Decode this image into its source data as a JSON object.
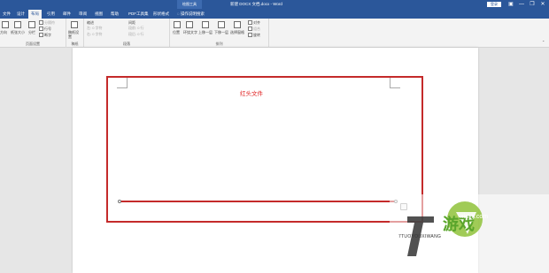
{
  "titlebar": {
    "context_tools": "绘图工具",
    "doc_title": "新建 DOCX 文档.docx  -  Word",
    "login": "登录",
    "minimize": "—",
    "restore": "❐",
    "close": "✕",
    "options": "▣"
  },
  "tabs": [
    "文件",
    "设计",
    "布局",
    "引用",
    "邮件",
    "审阅",
    "视图",
    "帮助",
    "PDF工具集",
    "形状格式"
  ],
  "tell_me": "操作说明搜索",
  "ribbon": {
    "page_setup": {
      "label": "页面设置",
      "direction": "方向",
      "size": "纸张大小",
      "columns": "分栏",
      "breaks": "分隔符",
      "line_numbers": "行号",
      "hyphenation": "断字"
    },
    "draft": {
      "label": "稿纸",
      "button": "稿纸设置"
    },
    "paragraph": {
      "label": "段落",
      "indent": "缩进",
      "spacing": "间距",
      "left": "左: 0 字符",
      "right": "右: 0 字符",
      "before": "段前: 0 行",
      "after": "段后: 0 行"
    },
    "arrange": {
      "label": "排列",
      "position": "位置",
      "wrap_text": "环绕文字",
      "bring_forward": "上移一层",
      "send_backward": "下移一层",
      "selection_pane": "选择窗格",
      "align": "对齐",
      "group": "组合",
      "rotate": "旋转"
    }
  },
  "document": {
    "header_text": "红头文件"
  },
  "watermark": {
    "brand_cn": "游戏",
    "brand_en": "7TUOYOUXIWANG",
    "site": "xiayx.com"
  },
  "colors": {
    "title_blue": "#2b579a",
    "frame_red": "#c42a2a",
    "text_red": "#e02020"
  }
}
